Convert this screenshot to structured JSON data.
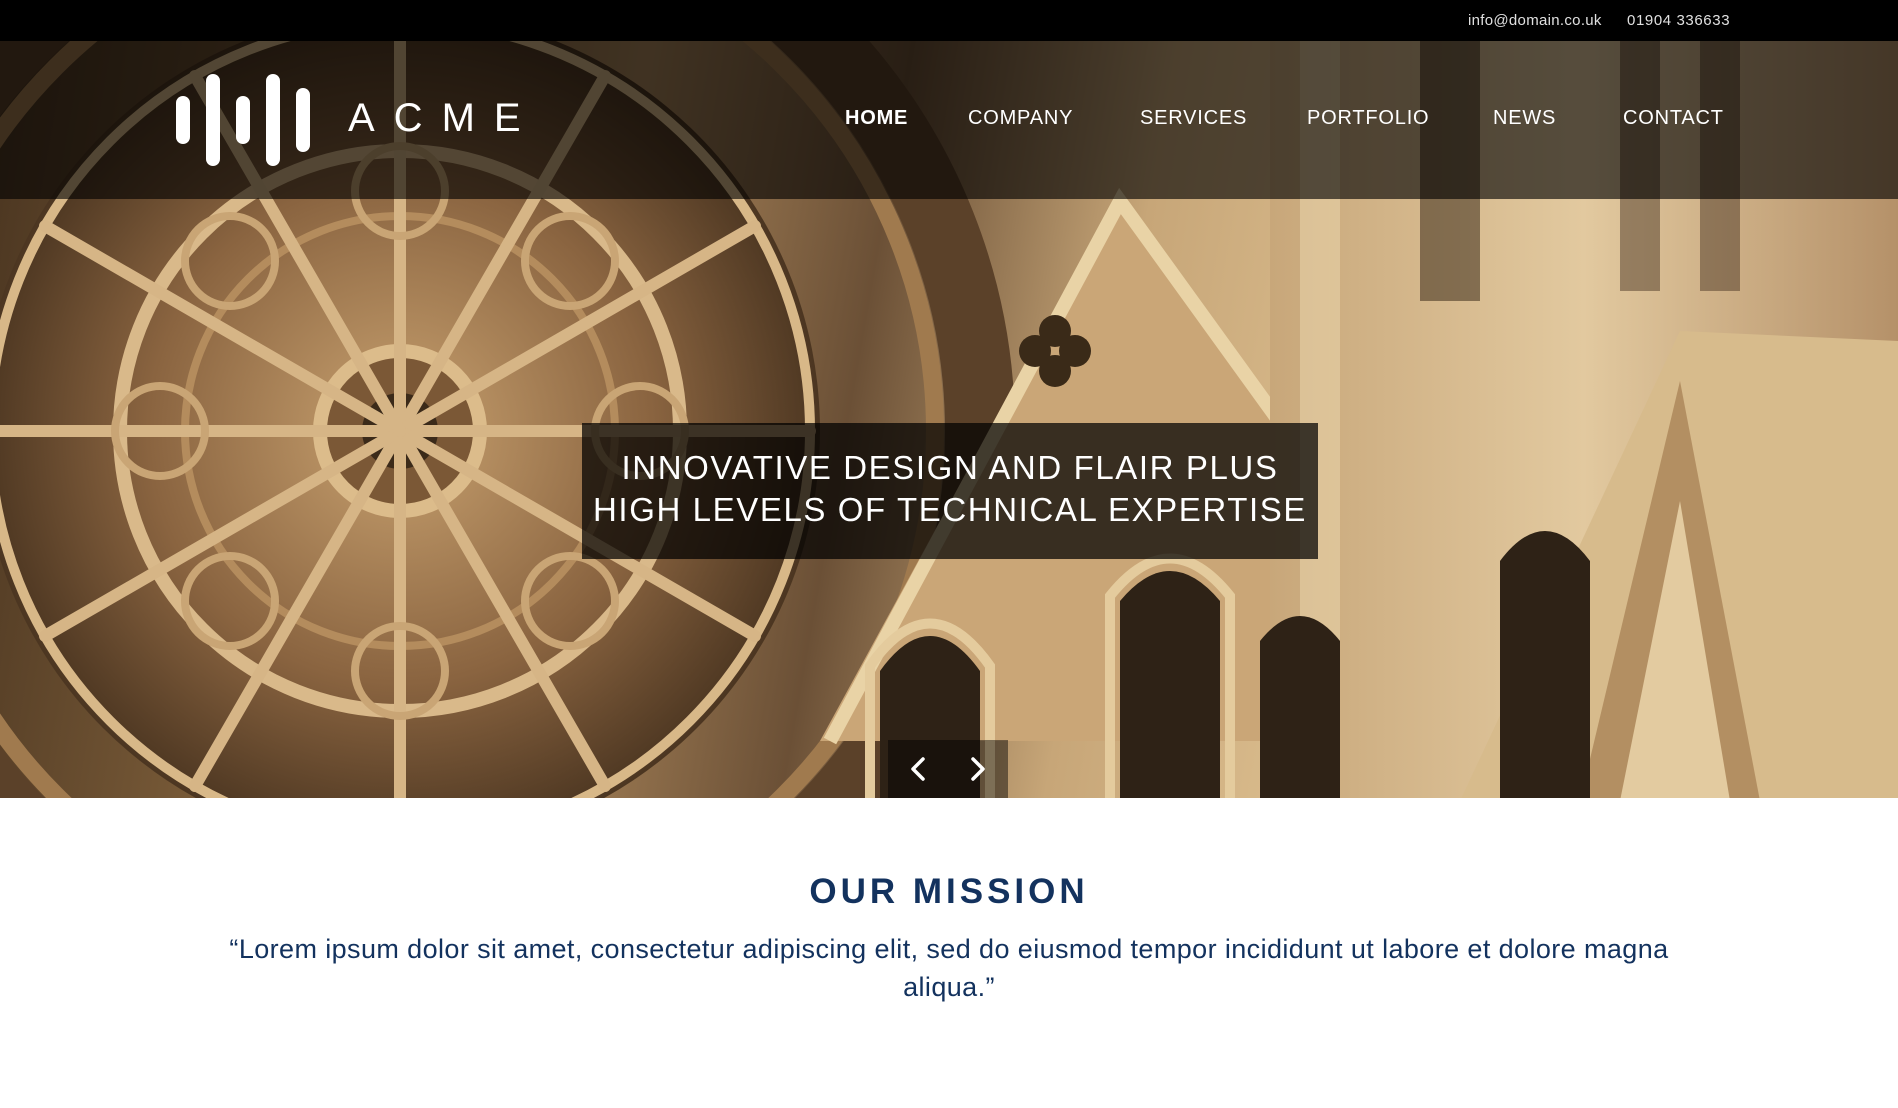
{
  "topbar": {
    "email": "info@domain.co.uk",
    "phone": "01904 336633"
  },
  "brand": {
    "name": "ACME",
    "logo_icon": "bars-logo-icon",
    "color": "#ffffff"
  },
  "nav": {
    "items": [
      {
        "label": "HOME",
        "active": true
      },
      {
        "label": "COMPANY",
        "active": false
      },
      {
        "label": "SERVICES",
        "active": false
      },
      {
        "label": "PORTFOLIO",
        "active": false
      },
      {
        "label": "NEWS",
        "active": false
      },
      {
        "label": "CONTACT",
        "active": false
      }
    ]
  },
  "hero": {
    "headline_line1": "INNOVATIVE DESIGN AND FLAIR PLUS",
    "headline_line2": "HIGH LEVELS OF TECHNICAL EXPERTISE",
    "prev_icon": "chevron-left-icon",
    "next_icon": "chevron-right-icon"
  },
  "mission": {
    "title": "OUR MISSION",
    "text": "“Lorem ipsum dolor sit amet, consectetur adipiscing elit, sed do eiusmod tempor incididunt ut labore et dolore magna aliqua.”"
  },
  "colors": {
    "topbar": "#000000",
    "accent_navy": "#13325e",
    "stone": "#c7a678"
  }
}
